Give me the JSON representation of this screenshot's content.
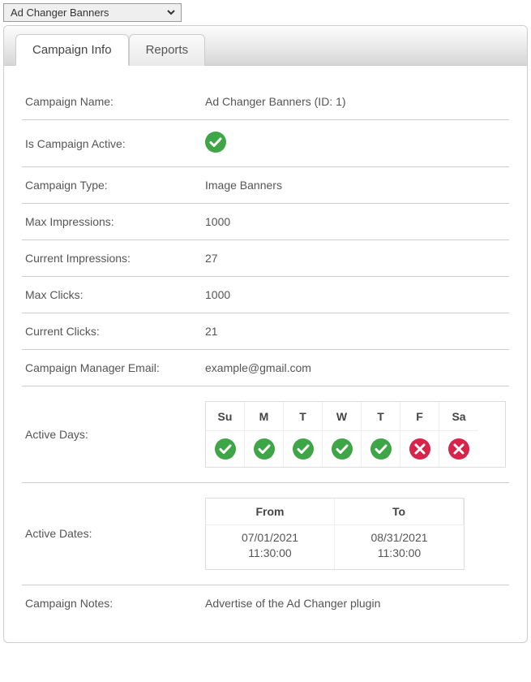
{
  "selector": {
    "selected": "Ad Changer Banners"
  },
  "tabs": {
    "info": "Campaign Info",
    "reports": "Reports"
  },
  "labels": {
    "campaign_name": "Campaign Name:",
    "is_active": "Is Campaign Active:",
    "campaign_type": "Campaign Type:",
    "max_impressions": "Max Impressions:",
    "current_impressions": "Current Impressions:",
    "max_clicks": "Max Clicks:",
    "current_clicks": "Current Clicks:",
    "manager_email": "Campaign Manager Email:",
    "active_days": "Active Days:",
    "active_dates": "Active Dates:",
    "campaign_notes": "Campaign Notes:"
  },
  "values": {
    "campaign_name": "Ad Changer Banners (ID: 1)",
    "is_active": true,
    "campaign_type": "Image Banners",
    "max_impressions": "1000",
    "current_impressions": "27",
    "max_clicks": "1000",
    "current_clicks": "21",
    "manager_email": "example@gmail.com",
    "campaign_notes": "Advertise of the Ad Changer plugin"
  },
  "days": {
    "headers": [
      "Su",
      "M",
      "T",
      "W",
      "T",
      "F",
      "Sa"
    ],
    "active": [
      true,
      true,
      true,
      true,
      true,
      false,
      false
    ]
  },
  "dates": {
    "from_label": "From",
    "to_label": "To",
    "from_date": "07/01/2021",
    "from_time": "11:30:00",
    "to_date": "08/31/2021",
    "to_time": "11:30:00"
  },
  "colors": {
    "ok": "#3fa648",
    "bad": "#d6244a"
  }
}
